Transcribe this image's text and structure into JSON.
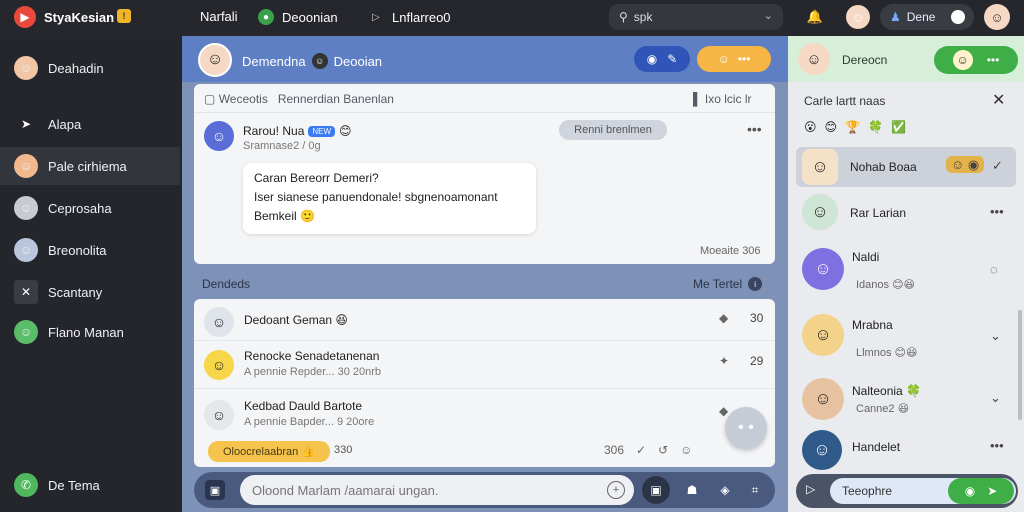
{
  "app": {
    "title": "StyaKesian",
    "badge": "!"
  },
  "topbar": {
    "nav": [
      "Narfali",
      "Deoonian",
      "Lnflarreo0"
    ],
    "search_value": "spk",
    "user_label": "Dene"
  },
  "sidebar": {
    "items": [
      {
        "label": "Deahadin",
        "icon": "☺"
      },
      {
        "label": "Alapa",
        "icon": "➤"
      },
      {
        "label": "Pale cirhiema",
        "icon": "☺"
      },
      {
        "label": "Ceprosaha",
        "icon": "☺"
      },
      {
        "label": "Breonolita",
        "icon": "☺"
      },
      {
        "label": "Scantany",
        "icon": "✕"
      },
      {
        "label": "Flano Manan",
        "icon": "☺"
      }
    ],
    "footer": "De Tema"
  },
  "chat": {
    "header_name": "Demendna",
    "header_name2": "Deooian",
    "thread_head": "Weceotis",
    "thread_head2": "Rennerdian Banenlan",
    "thread_icons": "Ixo lcic lr",
    "message": {
      "name": "Rarou! Nua",
      "tag": "NEW",
      "sub": "Sramnase2 / 0g",
      "pill": "Renni brenlmen",
      "bubble_line1": "Caran Bereorr Demeri?",
      "bubble_line2": "Iser sianese panuendonale! sbgnenoamonant",
      "bubble_line3": "Bemkeil"
    },
    "card_footer": "Moeaite 306",
    "section_label": "Dendeds",
    "section_right": "Me Tertel",
    "list": [
      {
        "title": "Dedoant Geman",
        "sub": "",
        "num": "30",
        "icon": "◆"
      },
      {
        "title": "Renocke Senadetanenan",
        "sub": "A pennie Repder... 30 20nrb",
        "num": "29",
        "icon": "✦"
      },
      {
        "title": "Kedbad Dauld Bartote",
        "sub": "A pennie Bapder... 9 20ore",
        "num": "",
        "icon": "◆"
      }
    ],
    "orange_pill": "Oloocrelaabran",
    "pill_num": "330",
    "footer_label": "306",
    "composer_placeholder": "Oloond Marlam /aamarai ungan."
  },
  "right": {
    "header_name": "Dereocn",
    "sub_title": "Carle lartt naas",
    "contacts": [
      {
        "name": "Nohab Boaa",
        "sub": ""
      },
      {
        "name": "Rar Larian",
        "sub": ""
      },
      {
        "name": "Naldi",
        "sub": "Idanos"
      },
      {
        "name": "Mrabna",
        "sub": "Llmnos"
      },
      {
        "name": "Nalteonia",
        "sub": "Canne2"
      },
      {
        "name": "Handelet",
        "sub": ""
      }
    ],
    "composer_value": "Teeophre"
  },
  "colors": {
    "accent_blue": "#5e7fc4",
    "accent_green": "#3fae46",
    "accent_orange": "#f6b544"
  }
}
